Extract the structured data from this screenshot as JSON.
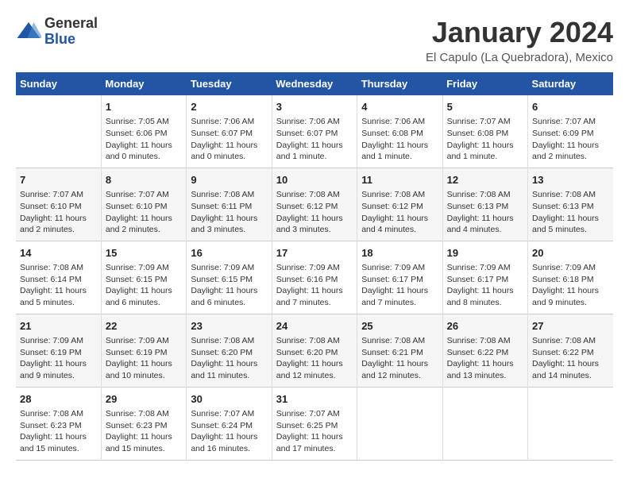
{
  "logo": {
    "general": "General",
    "blue": "Blue"
  },
  "title": "January 2024",
  "subtitle": "El Capulo (La Quebradora), Mexico",
  "days_of_week": [
    "Sunday",
    "Monday",
    "Tuesday",
    "Wednesday",
    "Thursday",
    "Friday",
    "Saturday"
  ],
  "weeks": [
    [
      {
        "day": "",
        "info": ""
      },
      {
        "day": "1",
        "info": "Sunrise: 7:05 AM\nSunset: 6:06 PM\nDaylight: 11 hours and 0 minutes."
      },
      {
        "day": "2",
        "info": "Sunrise: 7:06 AM\nSunset: 6:07 PM\nDaylight: 11 hours and 0 minutes."
      },
      {
        "day": "3",
        "info": "Sunrise: 7:06 AM\nSunset: 6:07 PM\nDaylight: 11 hours and 1 minute."
      },
      {
        "day": "4",
        "info": "Sunrise: 7:06 AM\nSunset: 6:08 PM\nDaylight: 11 hours and 1 minute."
      },
      {
        "day": "5",
        "info": "Sunrise: 7:07 AM\nSunset: 6:08 PM\nDaylight: 11 hours and 1 minute."
      },
      {
        "day": "6",
        "info": "Sunrise: 7:07 AM\nSunset: 6:09 PM\nDaylight: 11 hours and 2 minutes."
      }
    ],
    [
      {
        "day": "7",
        "info": "Sunrise: 7:07 AM\nSunset: 6:10 PM\nDaylight: 11 hours and 2 minutes."
      },
      {
        "day": "8",
        "info": "Sunrise: 7:07 AM\nSunset: 6:10 PM\nDaylight: 11 hours and 2 minutes."
      },
      {
        "day": "9",
        "info": "Sunrise: 7:08 AM\nSunset: 6:11 PM\nDaylight: 11 hours and 3 minutes."
      },
      {
        "day": "10",
        "info": "Sunrise: 7:08 AM\nSunset: 6:12 PM\nDaylight: 11 hours and 3 minutes."
      },
      {
        "day": "11",
        "info": "Sunrise: 7:08 AM\nSunset: 6:12 PM\nDaylight: 11 hours and 4 minutes."
      },
      {
        "day": "12",
        "info": "Sunrise: 7:08 AM\nSunset: 6:13 PM\nDaylight: 11 hours and 4 minutes."
      },
      {
        "day": "13",
        "info": "Sunrise: 7:08 AM\nSunset: 6:13 PM\nDaylight: 11 hours and 5 minutes."
      }
    ],
    [
      {
        "day": "14",
        "info": "Sunrise: 7:08 AM\nSunset: 6:14 PM\nDaylight: 11 hours and 5 minutes."
      },
      {
        "day": "15",
        "info": "Sunrise: 7:09 AM\nSunset: 6:15 PM\nDaylight: 11 hours and 6 minutes."
      },
      {
        "day": "16",
        "info": "Sunrise: 7:09 AM\nSunset: 6:15 PM\nDaylight: 11 hours and 6 minutes."
      },
      {
        "day": "17",
        "info": "Sunrise: 7:09 AM\nSunset: 6:16 PM\nDaylight: 11 hours and 7 minutes."
      },
      {
        "day": "18",
        "info": "Sunrise: 7:09 AM\nSunset: 6:17 PM\nDaylight: 11 hours and 7 minutes."
      },
      {
        "day": "19",
        "info": "Sunrise: 7:09 AM\nSunset: 6:17 PM\nDaylight: 11 hours and 8 minutes."
      },
      {
        "day": "20",
        "info": "Sunrise: 7:09 AM\nSunset: 6:18 PM\nDaylight: 11 hours and 9 minutes."
      }
    ],
    [
      {
        "day": "21",
        "info": "Sunrise: 7:09 AM\nSunset: 6:19 PM\nDaylight: 11 hours and 9 minutes."
      },
      {
        "day": "22",
        "info": "Sunrise: 7:09 AM\nSunset: 6:19 PM\nDaylight: 11 hours and 10 minutes."
      },
      {
        "day": "23",
        "info": "Sunrise: 7:08 AM\nSunset: 6:20 PM\nDaylight: 11 hours and 11 minutes."
      },
      {
        "day": "24",
        "info": "Sunrise: 7:08 AM\nSunset: 6:20 PM\nDaylight: 11 hours and 12 minutes."
      },
      {
        "day": "25",
        "info": "Sunrise: 7:08 AM\nSunset: 6:21 PM\nDaylight: 11 hours and 12 minutes."
      },
      {
        "day": "26",
        "info": "Sunrise: 7:08 AM\nSunset: 6:22 PM\nDaylight: 11 hours and 13 minutes."
      },
      {
        "day": "27",
        "info": "Sunrise: 7:08 AM\nSunset: 6:22 PM\nDaylight: 11 hours and 14 minutes."
      }
    ],
    [
      {
        "day": "28",
        "info": "Sunrise: 7:08 AM\nSunset: 6:23 PM\nDaylight: 11 hours and 15 minutes."
      },
      {
        "day": "29",
        "info": "Sunrise: 7:08 AM\nSunset: 6:23 PM\nDaylight: 11 hours and 15 minutes."
      },
      {
        "day": "30",
        "info": "Sunrise: 7:07 AM\nSunset: 6:24 PM\nDaylight: 11 hours and 16 minutes."
      },
      {
        "day": "31",
        "info": "Sunrise: 7:07 AM\nSunset: 6:25 PM\nDaylight: 11 hours and 17 minutes."
      },
      {
        "day": "",
        "info": ""
      },
      {
        "day": "",
        "info": ""
      },
      {
        "day": "",
        "info": ""
      }
    ]
  ]
}
